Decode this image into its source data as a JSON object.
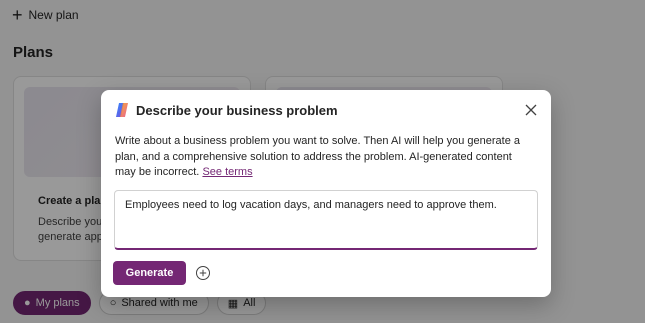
{
  "topbar": {
    "new_plan_label": "New plan"
  },
  "plans": {
    "title": "Plans"
  },
  "cards": [
    {
      "title": "Create a plan",
      "desc": "Describe your generate apps"
    },
    {
      "title": "",
      "desc": ""
    }
  ],
  "filters": [
    {
      "label": "My plans",
      "icon": "person-icon",
      "active": true
    },
    {
      "label": "Shared with me",
      "icon": "people-icon",
      "active": false
    },
    {
      "label": "All",
      "icon": "grid-icon",
      "active": false
    }
  ],
  "dialog": {
    "title": "Describe your business problem",
    "description": "Write about a business problem you want to solve. Then AI will help you generate a plan, and a comprehensive solution to address the problem. AI-generated content may be incorrect.",
    "see_terms": "See terms",
    "input_value": "Employees need to log vacation days, and managers need to approve them.",
    "generate_label": "Generate"
  },
  "colors": {
    "accent": "#742774"
  }
}
